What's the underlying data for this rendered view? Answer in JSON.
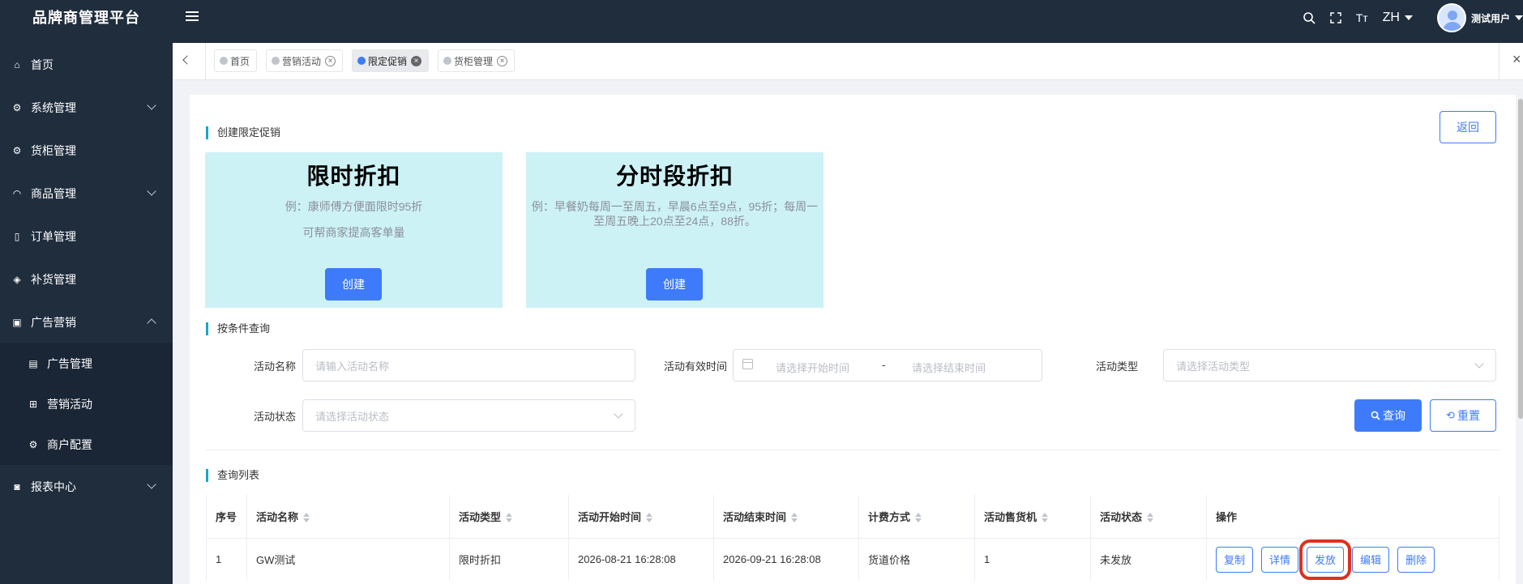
{
  "app": {
    "brand": "品牌商管理平台"
  },
  "header": {
    "lang": "ZH",
    "font_icon": "Tт",
    "user_name": "测试用户"
  },
  "sidebar": {
    "items": [
      {
        "label": "首页",
        "icon": "home-icon"
      },
      {
        "label": "系统管理",
        "icon": "gear-icon"
      },
      {
        "label": "货柜管理",
        "icon": "gear-icon"
      },
      {
        "label": "商品管理",
        "icon": "bag-icon"
      },
      {
        "label": "订单管理",
        "icon": "document-icon"
      },
      {
        "label": "补货管理",
        "icon": "box-icon"
      },
      {
        "label": "广告营销",
        "icon": "briefcase-icon"
      },
      {
        "label": "报表中心",
        "icon": "chart-icon"
      }
    ],
    "submenu": [
      {
        "label": "广告管理",
        "icon": "document-icon"
      },
      {
        "label": "营销活动",
        "icon": "gift-icon"
      },
      {
        "label": "商户配置",
        "icon": "gear-icon"
      }
    ]
  },
  "tabs": [
    {
      "label": "首页"
    },
    {
      "label": "营销活动"
    },
    {
      "label": "限定促销"
    },
    {
      "label": "货柜管理"
    }
  ],
  "create_section": {
    "title": "创建限定促销",
    "back_label": "返回",
    "cards": [
      {
        "title": "限时折扣",
        "desc1": "例：康师傅方便面限时95折",
        "desc2": "可帮商家提高客单量",
        "button": "创建"
      },
      {
        "title": "分时段折扣",
        "desc1": "例：早餐奶每周一至周五，早晨6点至9点，95折；每周一至周五晚上20点至24点，88折。",
        "desc2": "",
        "button": "创建"
      }
    ]
  },
  "query_section": {
    "title": "按条件查询",
    "name_label": "活动名称",
    "name_placeholder": "请输入活动名称",
    "time_label": "活动有效时间",
    "start_placeholder": "请选择开始时间",
    "range_sep": "-",
    "end_placeholder": "请选择结束时间",
    "type_label": "活动类型",
    "type_placeholder": "请选择活动类型",
    "status_label": "活动状态",
    "status_placeholder": "请选择活动状态",
    "search_label": "查询",
    "reset_label": "重置"
  },
  "list_section": {
    "title": "查询列表",
    "columns": [
      "序号",
      "活动名称",
      "活动类型",
      "活动开始时间",
      "活动结束时间",
      "计费方式",
      "活动售货机",
      "活动状态",
      "操作"
    ],
    "rows": [
      {
        "index": "1",
        "name": "GW测试",
        "type": "限时折扣",
        "start": "2026-08-21 16:28:08",
        "end": "2026-09-21 16:28:08",
        "billing": "货道价格",
        "machines": "1",
        "status": "未发放"
      }
    ],
    "actions": [
      "复制",
      "详情",
      "发放",
      "编辑",
      "删除"
    ]
  }
}
